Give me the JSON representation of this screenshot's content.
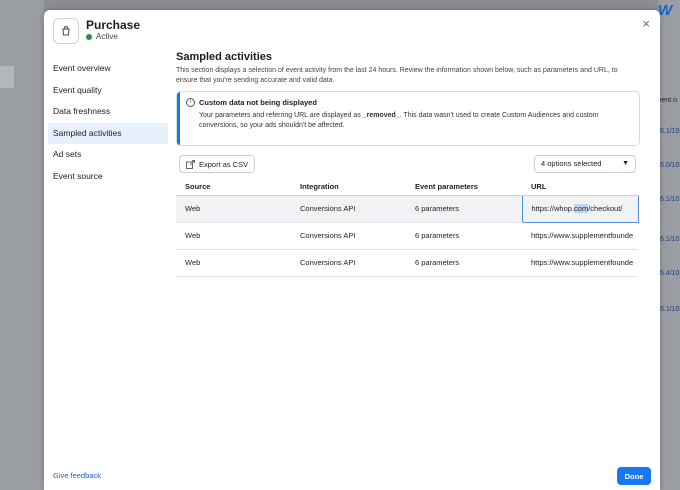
{
  "header": {
    "title": "Purchase",
    "status": "Active",
    "close_glyph": "×"
  },
  "nav": {
    "items": [
      {
        "label": "Event overview"
      },
      {
        "label": "Event quality"
      },
      {
        "label": "Data freshness"
      },
      {
        "label": "Sampled activities",
        "active": true
      },
      {
        "label": "Ad sets"
      },
      {
        "label": "Event source"
      }
    ]
  },
  "section": {
    "title": "Sampled activities",
    "description": "This section displays a selection of event activity from the last 24 hours. Review the information shown below, such as parameters and URL, to ensure that you're sending accurate and valid data."
  },
  "notice": {
    "title": "Custom data not being displayed",
    "text_before": "Your parameters and referring URL are displayed as ",
    "code": "_removed_",
    "text_after": ". This data wasn't used to create Custom Audiences and custom conversions, so your ads shouldn't be affected."
  },
  "toolbar": {
    "export_label": "Export as CSV",
    "select_value": "4 options selected"
  },
  "table": {
    "headers": [
      "Source",
      "Integration",
      "Event parameters",
      "URL"
    ],
    "rows": [
      {
        "source": "Web",
        "integration": "Conversions API",
        "params": "6 parameters",
        "url_a": "https://whop.",
        "url_hl": "com",
        "url_b": "/checkout/"
      },
      {
        "source": "Web",
        "integration": "Conversions API",
        "params": "6 parameters",
        "url": "https://www.supplementfounde"
      },
      {
        "source": "Web",
        "integration": "Conversions API",
        "params": "6 parameters",
        "url": "https://www.supplementfounde"
      }
    ]
  },
  "footer": {
    "feedback_label": "Give feedback",
    "done_label": "Done"
  },
  "background": {
    "brand_letter": "W",
    "event_label": "vent n",
    "values": [
      "6.1/10",
      "6.0/10",
      "6.1/10",
      "6.1/10",
      "6.4/10",
      "6.1/10"
    ]
  },
  "icons": {
    "header": "shopping-bag-icon",
    "notice": "info-icon",
    "export": "export-icon",
    "select": "chevron-down-icon",
    "close": "close-icon"
  },
  "colors": {
    "accent": "#1877f2",
    "status_active": "#2a8f4d",
    "nav_active_bg": "#e7f0fb"
  }
}
